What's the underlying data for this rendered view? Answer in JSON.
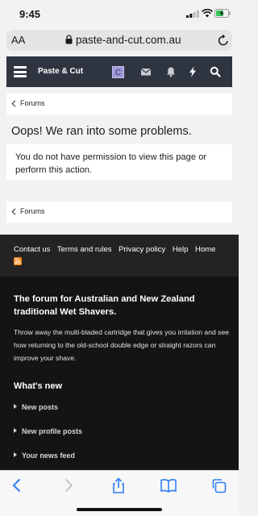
{
  "status_bar": {
    "time": "9:45"
  },
  "browser": {
    "text_size_label": "AA",
    "url": "paste-and-cut.com.au"
  },
  "navbar": {
    "brand": "Paste & Cut",
    "avatar_letter": "C"
  },
  "breadcrumb_top": {
    "label": "Forums"
  },
  "page": {
    "title": "Oops! We ran into some problems.",
    "message": "You do not have permission to view this page or perform this action."
  },
  "breadcrumb_bottom": {
    "label": "Forums"
  },
  "footer": {
    "links": [
      "Contact us",
      "Terms and rules",
      "Privacy policy",
      "Help",
      "Home"
    ],
    "heading": "The forum for Australian and New Zealand traditional Wet Shavers.",
    "description": "Throw away the multi-bladed cartridge that gives you irritation and see how returning to the old-school double edge or straight razors can improve your shave.",
    "whats_new_title": "What's new",
    "whats_new_items": [
      "New posts",
      "New profile posts",
      "Your news feed"
    ]
  },
  "colors": {
    "accent": "#2f7ef6",
    "navbar": "#2f3540",
    "footer": "#141414",
    "rss": "#f58a1f"
  }
}
